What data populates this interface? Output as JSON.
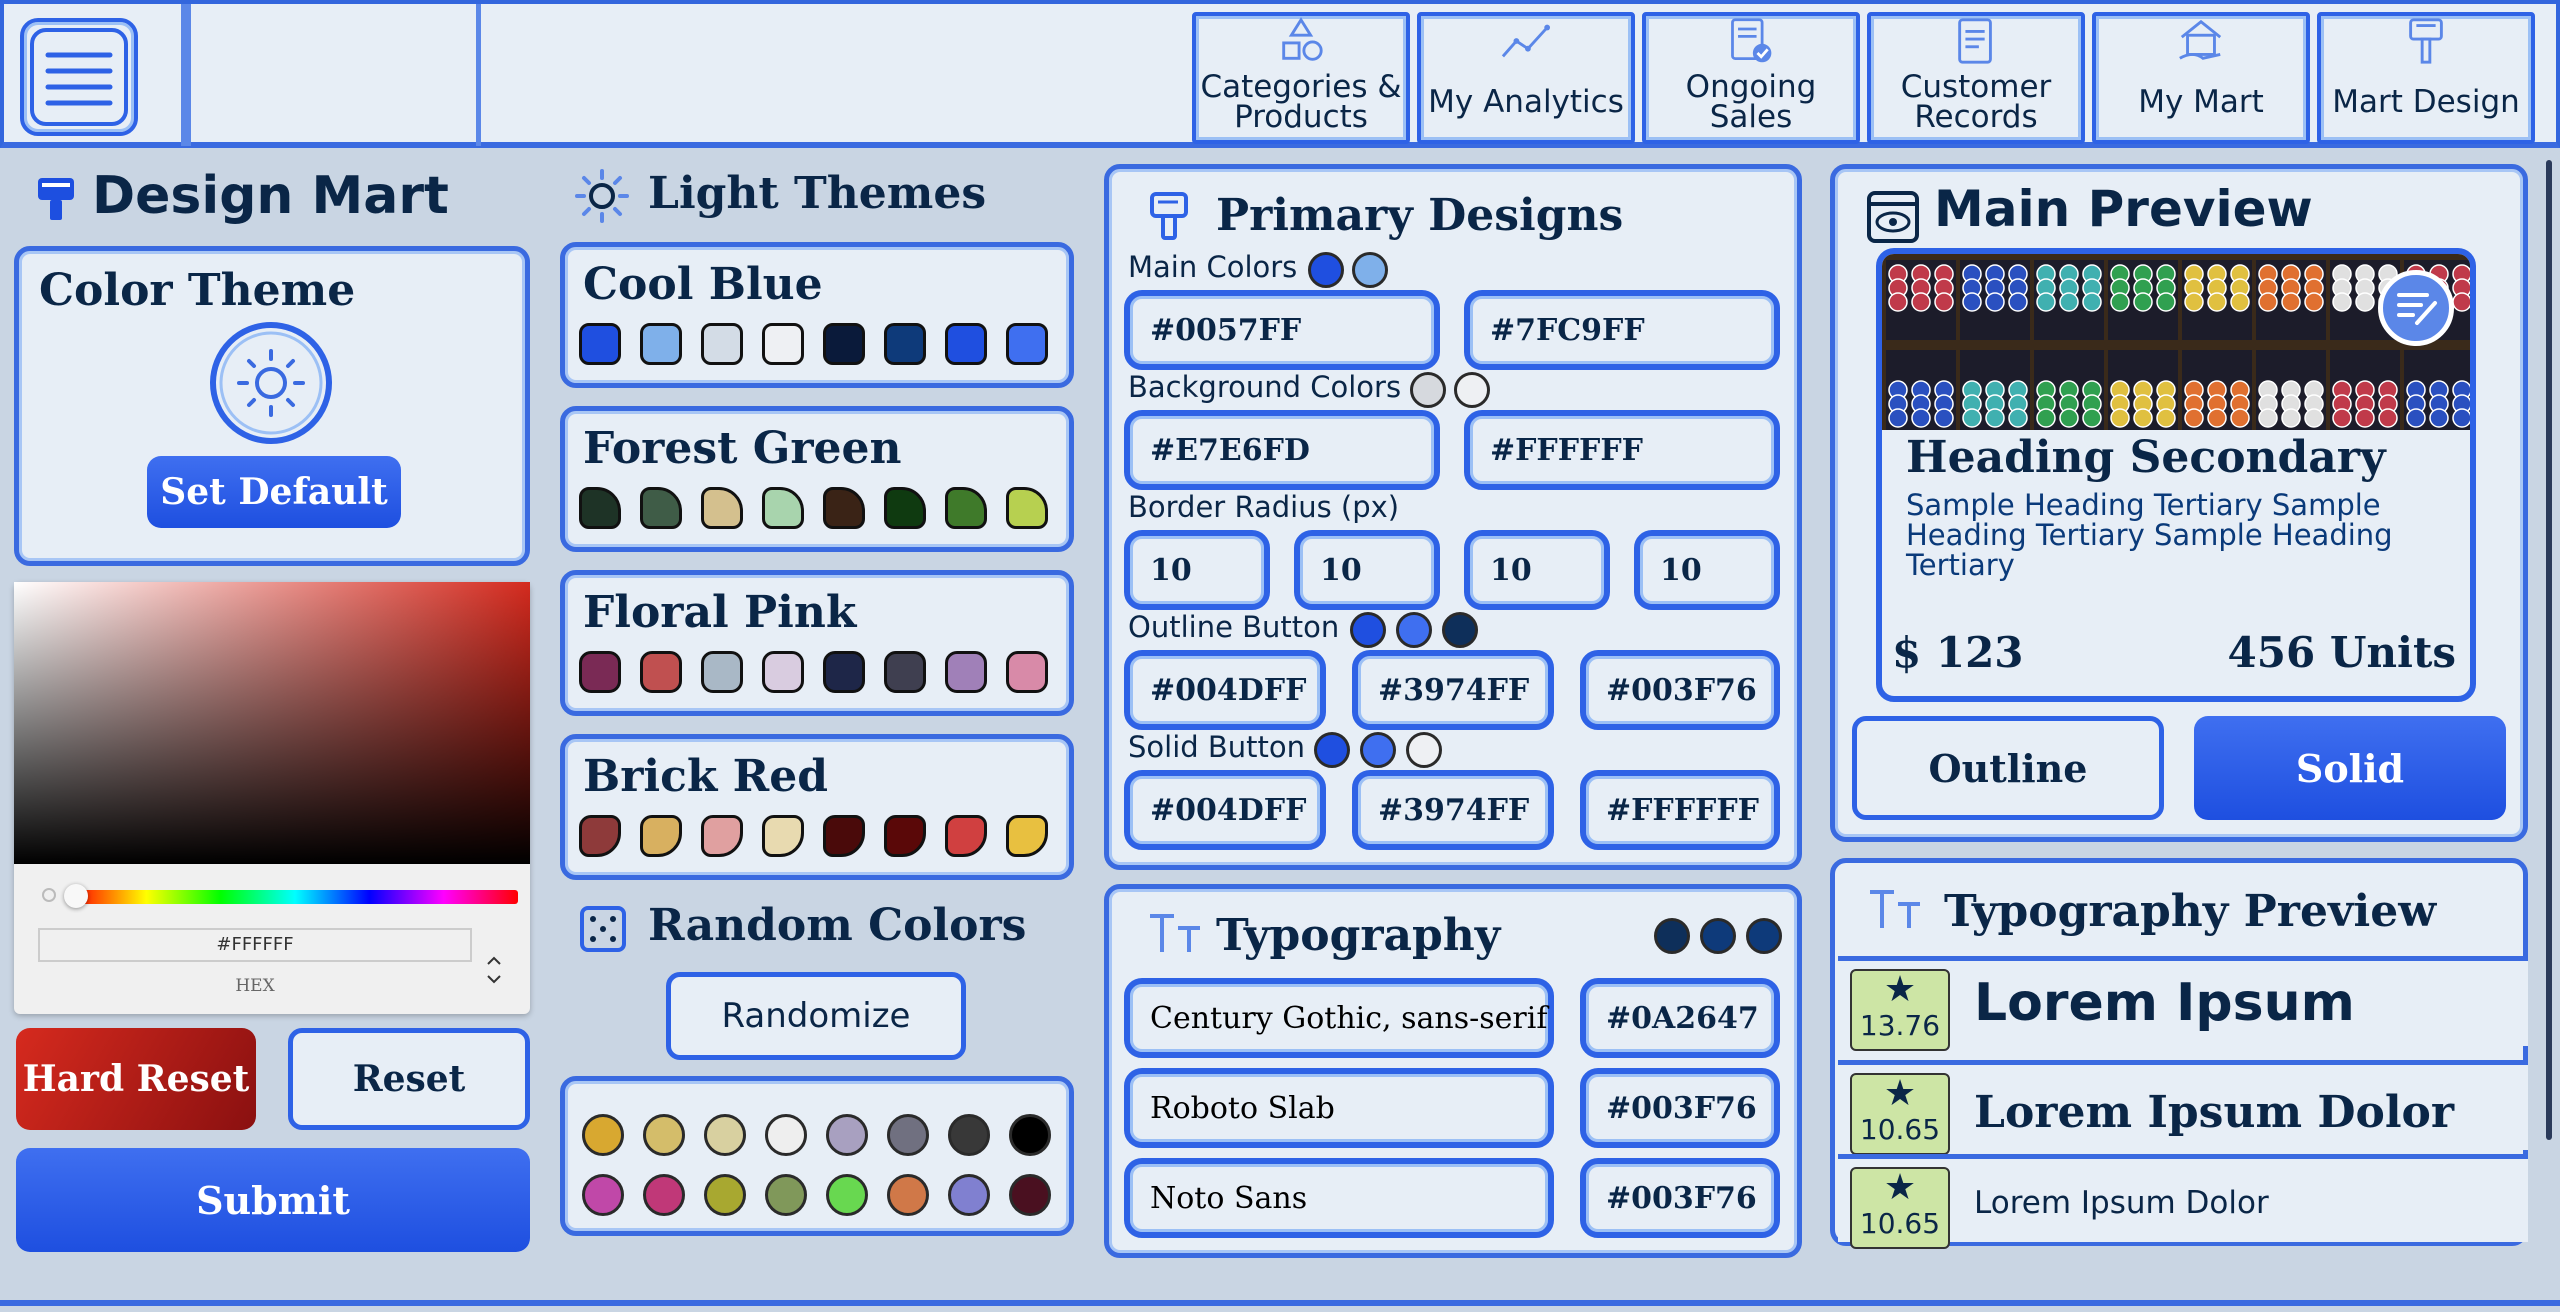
{
  "nav": {
    "items": [
      {
        "label": "Categories & Products",
        "icon": "shapes-icon"
      },
      {
        "label": "My Analytics",
        "icon": "analytics-icon"
      },
      {
        "label": "Ongoing Sales",
        "icon": "sales-document-icon"
      },
      {
        "label": "Customer Records",
        "icon": "records-icon"
      },
      {
        "label": "My Mart",
        "icon": "store-icon"
      },
      {
        "label": "Mart Design",
        "icon": "paint-brush-icon"
      }
    ]
  },
  "design_mart": {
    "title": "Design Mart",
    "color_theme_title": "Color Theme",
    "set_default": "Set Default",
    "picker": {
      "hex_value": "#FFFFFF",
      "hex_label": "HEX"
    },
    "hard_reset": "Hard Reset",
    "reset": "Reset",
    "submit": "Submit"
  },
  "light_themes": {
    "title": "Light Themes",
    "themes": [
      {
        "name": "Cool Blue",
        "colors": [
          "#1f4fe0",
          "#7fb0ea",
          "#d3dce6",
          "#eef0f3",
          "#0a1a3a",
          "#0e3a7a",
          "#1f4fe0",
          "#3f6ff0"
        ]
      },
      {
        "name": "Forest Green",
        "colors": [
          "#1e3326",
          "#3f5c47",
          "#d4c08e",
          "#a8d4ad",
          "#3a2316",
          "#0f3a10",
          "#3f7a2a",
          "#b7d050"
        ]
      },
      {
        "name": "Floral Pink",
        "colors": [
          "#7a2a55",
          "#c05050",
          "#a9b8c6",
          "#d9cce0",
          "#1e2648",
          "#3f3f50",
          "#a080b8",
          "#d88aa8"
        ]
      },
      {
        "name": "Brick Red",
        "colors": [
          "#8e3a3a",
          "#d8b060",
          "#e0a0a0",
          "#e8dab0",
          "#4a0a0a",
          "#5a0808",
          "#d04040",
          "#e8c040"
        ]
      }
    ]
  },
  "random_colors": {
    "title": "Random Colors",
    "button": "Randomize",
    "row1": [
      "#d8a830",
      "#d4bd6a",
      "#d8d0a0",
      "#eeeeee",
      "#a8a0c0",
      "#707080",
      "#383838",
      "#000000"
    ],
    "row2": [
      "#c048a8",
      "#c03878",
      "#a8a830",
      "#80985a",
      "#68d850",
      "#d07848",
      "#8080d0",
      "#4a1020"
    ]
  },
  "primary_designs": {
    "title": "Primary Designs",
    "main_colors_label": "Main Colors",
    "main_colors": [
      "#0057FF",
      "#7FC9FF"
    ],
    "background_colors_label": "Background Colors",
    "background_colors": [
      "#E7E6FD",
      "#FFFFFF"
    ],
    "border_radius_label": "Border Radius (px)",
    "border_radius": [
      "10",
      "10",
      "10",
      "10"
    ],
    "outline_button_label": "Outline Button",
    "outline_button": [
      "#004DFF",
      "#3974FF",
      "#003F76"
    ],
    "solid_button_label": "Solid Button",
    "solid_button": [
      "#004DFF",
      "#3974FF",
      "#FFFFFF"
    ]
  },
  "typography": {
    "title": "Typography",
    "rows": [
      {
        "font": "Century Gothic, sans-serif",
        "color": "#0A2647"
      },
      {
        "font": "Roboto Slab",
        "color": "#003F76"
      },
      {
        "font": "Noto Sans",
        "color": "#003F76"
      }
    ]
  },
  "main_preview": {
    "title": "Main Preview",
    "heading": "Heading Secondary",
    "body": "Sample Heading Tertiary Sample Heading Tertiary Sample Heading Tertiary",
    "price": "$ 123",
    "units": "456 Units",
    "outline": "Outline",
    "solid": "Solid"
  },
  "typography_preview": {
    "title": "Typography Preview",
    "rows": [
      {
        "rating": "13.76",
        "text": "Lorem Ipsum"
      },
      {
        "rating": "10.65",
        "text": "Lorem Ipsum Dolor"
      },
      {
        "rating": "10.65",
        "text": "Lorem Ipsum Dolor"
      }
    ]
  }
}
